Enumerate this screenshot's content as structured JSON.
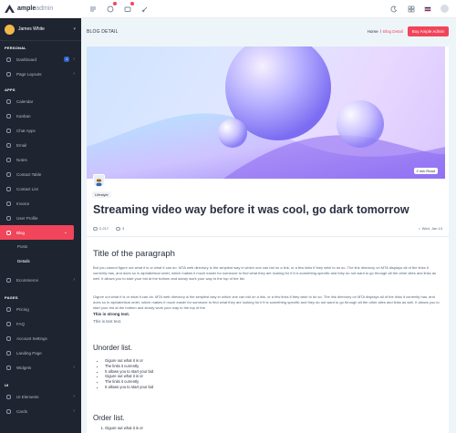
{
  "brand": {
    "name": "ample",
    "suffix": "admin"
  },
  "topbar": {
    "icons": [
      "menu-icon",
      "bell-icon",
      "mail-icon",
      "brush-icon"
    ],
    "right_icons": [
      "moon-icon",
      "grid-icon",
      "uk-flag-icon",
      "avatar"
    ]
  },
  "user": {
    "name": "James White"
  },
  "sidebar": {
    "sections": {
      "personal": "PERSONAL",
      "apps": "APPS",
      "pages": "PAGES",
      "ui": "UI"
    },
    "personal_items": [
      {
        "label": "Dashboard",
        "badge": "4"
      },
      {
        "label": "Page Layouts"
      }
    ],
    "app_items": [
      {
        "label": "Calendar"
      },
      {
        "label": "Kanban"
      },
      {
        "label": "Chat Apps"
      },
      {
        "label": "Email"
      },
      {
        "label": "Notes"
      },
      {
        "label": "Contact Table"
      },
      {
        "label": "Contact List"
      },
      {
        "label": "Invoice"
      },
      {
        "label": "User Profile"
      },
      {
        "label": "Blog"
      }
    ],
    "blog_sub": [
      {
        "label": "Posts"
      },
      {
        "label": "Details"
      }
    ],
    "ecommerce": {
      "label": "Ecommerce"
    },
    "page_items": [
      {
        "label": "Pricing"
      },
      {
        "label": "FAQ"
      },
      {
        "label": "Account Settings"
      },
      {
        "label": "Landing Page"
      },
      {
        "label": "Widgets"
      }
    ],
    "ui_items": [
      {
        "label": "UI Elements"
      },
      {
        "label": "Cards"
      }
    ]
  },
  "header": {
    "title": "BLOG DETAIL",
    "breadcrumb": [
      "Home",
      "Blog Detail"
    ],
    "buy_label": "Buy Ample Admin"
  },
  "post": {
    "read_time": "2 min Read",
    "category": "Lifestyle",
    "title": "Streaming video way before it was cool, go dark tomorrow",
    "views": "2,217",
    "comments": "3",
    "date": "Wed, Jan 13",
    "h_paragraph": "Title of the paragraph",
    "para1": "But you cannot figure out what it is or what it can do. MTA web directory is the simplest way in which one can bid on a link, or a few links if they wish to do so. The link directory on MTA displays all of the links it currently has, and does so in alphabetical order, which makes it much easier for someone to find what they are looking for if it is something specific and they do not want to go through all the other sites and links as well. It allows you to start your bid at the bottom and slowly work your way to the top of the list.",
    "para2": "Gigure out what it is or what it can do. MTA web directory is the simplest way in which one can bid on a link, or a few links if they wish to do so. The link directory on MTA displays all of the links it currently has, and does so in alphabetical order, which makes it much easier for someone to find what they are looking for if it is something specific and they do not want to go through all the other sites and links as well. It allows you to start your bid at the bottom and slowly work your way to the top of the",
    "strong": "This is strong text.",
    "plain": "This is text text.",
    "h_unorder": "Unorder list.",
    "ul": [
      "Gigure out what it is or",
      "The links it currently",
      "It allows you to start your bid",
      "Gigure out what it is or",
      "The links it currently",
      "It allows you to start your bid"
    ],
    "h_order": "Order list.",
    "ol": [
      "Gigure out what it is or"
    ]
  }
}
